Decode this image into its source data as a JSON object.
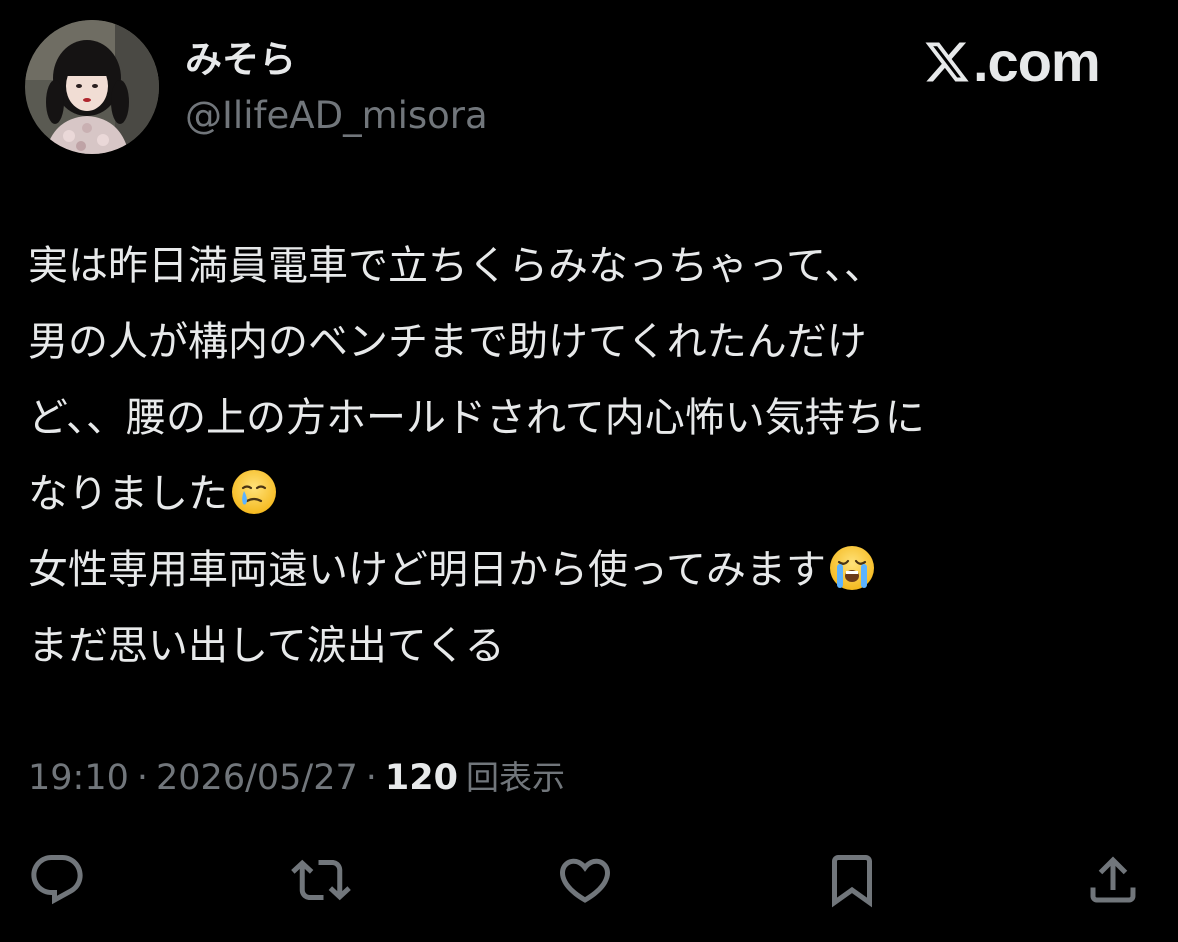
{
  "author": {
    "display_name": "みそら",
    "handle": "@IlifeAD_misora",
    "avatar": "profile-photo"
  },
  "brand": {
    "logo": "x-logo-icon",
    "text": ".com"
  },
  "tweet": {
    "lines": [
      "実は昨日満員電車で立ちくらみなっちゃって、、",
      "男の人が構内のベンチまで助けてくれたんだけ",
      "ど、、腰の上の方ホールドされて内心怖い気持ちに",
      "なりました",
      "女性専用車両遠いけど明日から使ってみます",
      "まだ思い出して涙出てくる"
    ],
    "emojis": {
      "line4": "face-holding-back-tears-emoji",
      "line5": "loudly-crying-face-emoji"
    }
  },
  "meta": {
    "time": "19:10",
    "separator": "·",
    "date": "2026/05/27",
    "views_count": "120",
    "views_label": "回表示"
  },
  "actions": {
    "reply": "reply-icon",
    "repost": "repost-icon",
    "like": "like-icon",
    "bookmark": "bookmark-icon",
    "share": "share-icon"
  },
  "colors": {
    "background": "#000000",
    "primary_text": "#e7e9ea",
    "secondary_text": "#71767b",
    "icon": "#71767b"
  }
}
